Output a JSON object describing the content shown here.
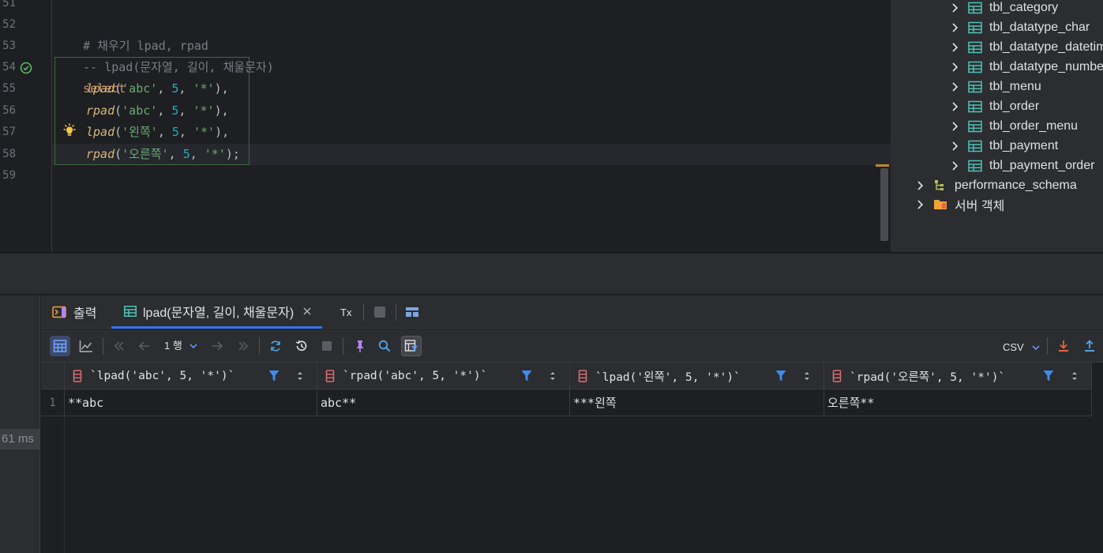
{
  "editor": {
    "line_numbers": [
      "51",
      "52",
      "53",
      "54",
      "55",
      "56",
      "57",
      "58",
      "59"
    ],
    "comment_line": "# 채우기 lpad, rpad",
    "comment2": "-- lpad(문자열, 길이, 채울문자)",
    "keyword_select": "select",
    "fn_lpad": "lpad",
    "fn_rpad": "rpad",
    "str_abc": "'abc'",
    "str_left": "'왼쪽'",
    "str_right": "'오른쪽'",
    "str_star": "'*'",
    "num_5": "5",
    "open_paren": "(",
    "sep": ", ",
    "close_comma": "),",
    "close_semi": ");"
  },
  "db_tree": {
    "tables": [
      "tbl_category",
      "tbl_datatype_char",
      "tbl_datatype_datetime",
      "tbl_datatype_number",
      "tbl_menu",
      "tbl_order",
      "tbl_order_menu",
      "tbl_payment",
      "tbl_payment_order"
    ],
    "schema": "performance_schema",
    "server_objects": "서버 객체"
  },
  "tabs": {
    "output": "출력",
    "result": "lpad(문자열, 길이, 채울문자)",
    "tx": "Tx"
  },
  "toolbar": {
    "page": "1 행",
    "export_format": "CSV"
  },
  "services": {
    "elapsed": "61 ms"
  },
  "grid": {
    "columns": [
      "`lpad('abc', 5, '*')`",
      "`rpad('abc', 5, '*')`",
      "`lpad('왼쪽', 5, '*')`",
      "`rpad('오른쪽', 5, '*')`"
    ],
    "rows": [
      {
        "num": "1",
        "cells": [
          "**abc",
          "abc**",
          "***왼쪽",
          "오른쪽**"
        ]
      }
    ]
  },
  "colors": {
    "accent": "#3574f0",
    "keyword": "#cf8e6d",
    "function": "#d5b778",
    "string": "#6aab73",
    "number": "#2aacb8",
    "table_icon": "#4fc1b8"
  }
}
